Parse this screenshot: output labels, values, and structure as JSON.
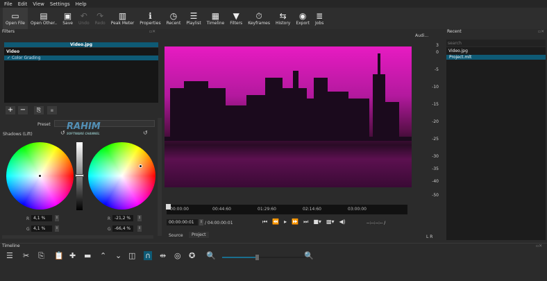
{
  "menu": [
    "File",
    "Edit",
    "View",
    "Settings",
    "Help"
  ],
  "toolbar": [
    {
      "label": "Open File",
      "icon": "open-file-icon",
      "glyph": "▭"
    },
    {
      "label": "Open Other..",
      "icon": "open-other-icon",
      "glyph": "▤"
    },
    {
      "label": "Save",
      "icon": "save-icon",
      "glyph": "▣"
    },
    {
      "label": "Undo",
      "icon": "undo-icon",
      "glyph": "↶",
      "disabled": true
    },
    {
      "label": "Redo",
      "icon": "redo-icon",
      "glyph": "↷",
      "disabled": true
    },
    {
      "label": "Peak Meter",
      "icon": "peak-meter-icon",
      "glyph": "▥"
    },
    {
      "label": "Properties",
      "icon": "properties-icon",
      "glyph": "ℹ"
    },
    {
      "label": "Recent",
      "icon": "recent-icon",
      "glyph": "◷"
    },
    {
      "label": "Playlist",
      "icon": "playlist-icon",
      "glyph": "☰"
    },
    {
      "label": "Timeline",
      "icon": "timeline-icon",
      "glyph": "▦"
    },
    {
      "label": "Filters",
      "icon": "filters-icon",
      "glyph": "▼"
    },
    {
      "label": "Keyframes",
      "icon": "keyframes-icon",
      "glyph": "⏱"
    },
    {
      "label": "History",
      "icon": "history-icon",
      "glyph": "⇆"
    },
    {
      "label": "Export",
      "icon": "export-icon",
      "glyph": "◉"
    },
    {
      "label": "Jobs",
      "icon": "jobs-icon",
      "glyph": "≣"
    }
  ],
  "filters": {
    "title": "Filters",
    "clip": "Video.jpg",
    "category": "Video",
    "items": [
      "Color Grading"
    ],
    "preset_label": "Preset",
    "section": "Shadows (Lift)",
    "left_wheel": {
      "r": "4,1 %",
      "g": "4,1 %"
    },
    "right_wheel": {
      "r": "-21,2 %",
      "g": "-66,4 %"
    }
  },
  "player": {
    "ruler": [
      "00:00:00",
      "00:44:60",
      "01:29:60",
      "02:14:60",
      "03:00:00"
    ],
    "timecode": "00:00:00:01",
    "duration": "/ 04:00:00:01",
    "inout": "--:--:--:-- /",
    "tabs": [
      "Source",
      "Project"
    ]
  },
  "audio": {
    "title": "Audi...",
    "scale": [
      "3",
      "0",
      "-5",
      "-10",
      "-15",
      "-20",
      "-25",
      "-30",
      "-35",
      "-40",
      "-50"
    ],
    "channels": "L R"
  },
  "recent": {
    "title": "Recent",
    "placeholder": "search",
    "items": [
      "Video.jpg",
      "Project.mlt"
    ],
    "selected": 1
  },
  "timeline": {
    "title": "Timeline",
    "zoom": 0.4
  },
  "watermark": {
    "name": "RAHIM",
    "sub": "SOFTWARE CHANNEL"
  }
}
